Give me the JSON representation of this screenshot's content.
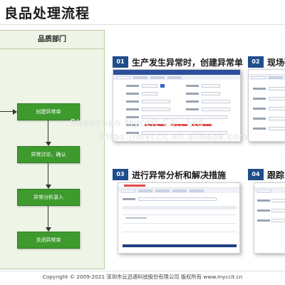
{
  "page": {
    "title": "良品处理流程"
  },
  "flow": {
    "department": "品质部门",
    "nodes": [
      "创建异常单",
      "异常讨论、确认",
      "异常分析录入",
      "关闭异常单"
    ]
  },
  "steps": [
    {
      "num": "01",
      "title": "生产发生异常时，创建异常单"
    },
    {
      "num": "02",
      "title": "现场确"
    },
    {
      "num": "03",
      "title": "进行异常分析和解决措施"
    },
    {
      "num": "04",
      "title": "跟踪"
    }
  ],
  "watermark": {
    "line1": "Shenzhen Myccit Co., Ltd",
    "line2": "https://myccit.en.alibaba.com"
  },
  "footer": {
    "text": "Copyright © 2009-2021  深圳市云迅通科技股份有限公司  版权所有  www.myccit.cn"
  },
  "colors": {
    "accent": "#1f4e8c",
    "flow_node": "#3f9a2e",
    "flow_bg": "#eef4e6",
    "app_header": "#2b4f9a"
  }
}
